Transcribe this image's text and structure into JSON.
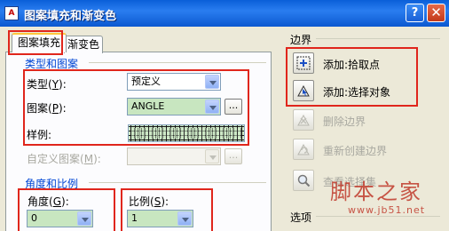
{
  "window": {
    "icon_text": "A",
    "title": "图案填充和渐变色",
    "help_label": "?",
    "close_label": "✕"
  },
  "tabs": [
    {
      "label": "图案填充",
      "active": true
    },
    {
      "label": "渐变色",
      "active": false
    }
  ],
  "type_and_pattern": {
    "heading": "类型和图案",
    "type_label": "类型",
    "type_key": "Y",
    "type_value": "预定义",
    "pattern_label": "图案",
    "pattern_key": "P",
    "pattern_value": "ANGLE",
    "pattern_button": "...",
    "swatch_label": "样例:",
    "custom_label": "自定义图案",
    "custom_key": "M",
    "custom_value": "",
    "custom_button": "..."
  },
  "angle_scale": {
    "heading": "角度和比例",
    "angle_label": "角度",
    "angle_key": "G",
    "angle_value": "0",
    "scale_label": "比例",
    "scale_key": "S",
    "scale_value": "1"
  },
  "boundaries": {
    "heading": "边界",
    "add_pick_points": "添加:拾取点",
    "add_select_objects": "添加:选择对象",
    "remove_boundaries": "删除边界",
    "recreate_boundary": "重新创建边界",
    "view_selections": "查看选择集"
  },
  "options": {
    "heading": "选项"
  },
  "watermark": {
    "title": "脚本之家",
    "url": "www.jb51.net"
  },
  "colors": {
    "highlight": "#e0261c",
    "heading_blue": "#0046d5",
    "selected_field": "#c8e6c0"
  }
}
